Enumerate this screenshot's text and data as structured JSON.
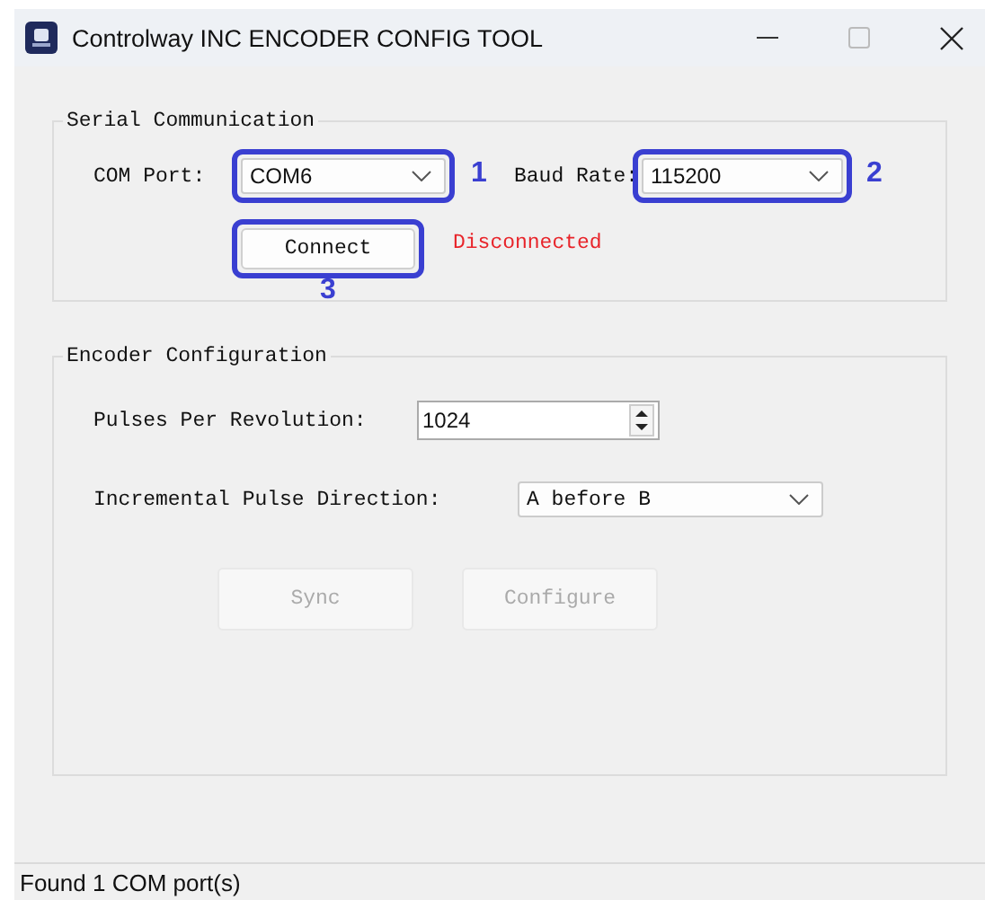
{
  "window": {
    "title": "Controlway INC ENCODER CONFIG TOOL"
  },
  "serial": {
    "title": "Serial Communication",
    "com_port": {
      "label": "COM Port:",
      "value": "COM6",
      "callout": "1"
    },
    "baud_rate": {
      "label": "Baud Rate:",
      "value": "115200",
      "callout": "2"
    },
    "connect": {
      "label": "Connect",
      "disabled": false,
      "callout": "3"
    },
    "status": "Disconnected"
  },
  "encoder": {
    "title": "Encoder Configuration",
    "pulses": {
      "label": "Pulses Per Revolution:",
      "value": "1024"
    },
    "direction": {
      "label": "Incremental Pulse Direction:",
      "value": "A before B"
    },
    "buttons": [
      {
        "label": "Sync",
        "disabled": true
      },
      {
        "label": "Configure",
        "disabled": true
      }
    ]
  },
  "status_bar": "Found 1 COM port(s)"
}
